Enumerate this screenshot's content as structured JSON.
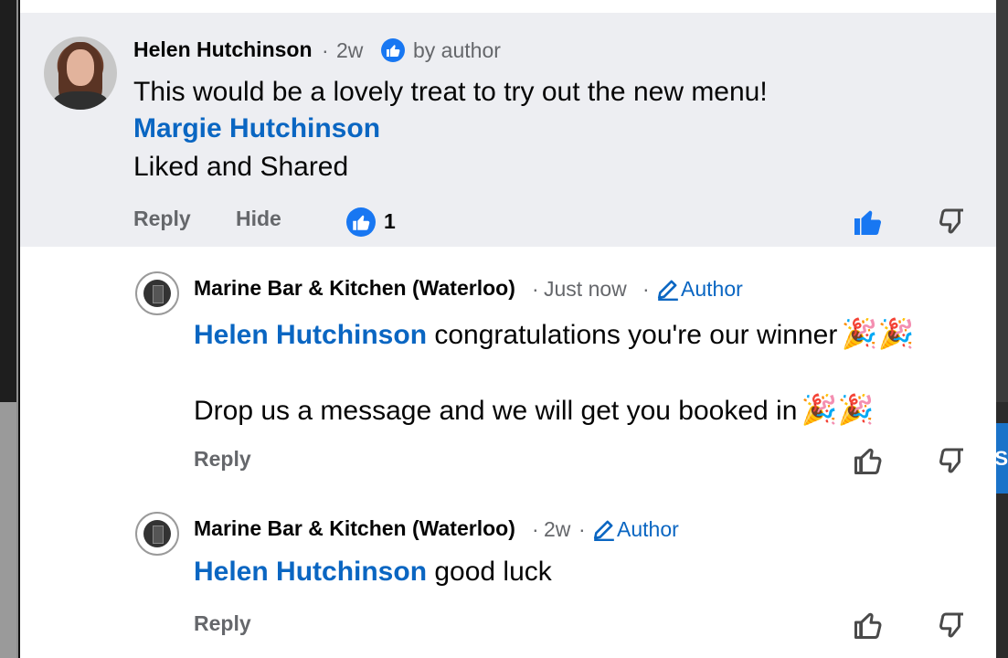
{
  "background": {
    "right_button_fragment": "S"
  },
  "comment": {
    "author": "Helen Hutchinson",
    "dot": "·",
    "time": "2w",
    "liked_by_author_label": "by author",
    "lines": [
      "This would be a lovely treat to try out the new menu!",
      "Liked and Shared"
    ],
    "mention": "Margie Hutchinson",
    "actions": {
      "reply": "Reply",
      "hide": "Hide"
    },
    "reaction_count": "1"
  },
  "replies": [
    {
      "author": "Marine Bar & Kitchen (Waterloo)",
      "dot": "·",
      "time": "Just now",
      "author_badge": "Author",
      "mention": "Helen Hutchinson",
      "text": " congratulations you're our winner",
      "emoji": "🎉🎉",
      "text2": "Drop us a message and we will get you booked in",
      "emoji2": "🎉🎉",
      "reply_label": "Reply"
    },
    {
      "author": "Marine Bar & Kitchen (Waterloo)",
      "dot": "·",
      "time": "2w",
      "author_badge": "Author",
      "mention": "Helen Hutchinson",
      "text": " good luck",
      "reply_label": "Reply"
    }
  ],
  "colors": {
    "accent": "#1877f2",
    "link": "#0a66c2",
    "highlight_bg": "#edeef2",
    "meta": "#65676b"
  },
  "icons": [
    "thumbs-up-icon",
    "thumbs-down-icon",
    "pencil-icon",
    "like-badge-icon"
  ]
}
